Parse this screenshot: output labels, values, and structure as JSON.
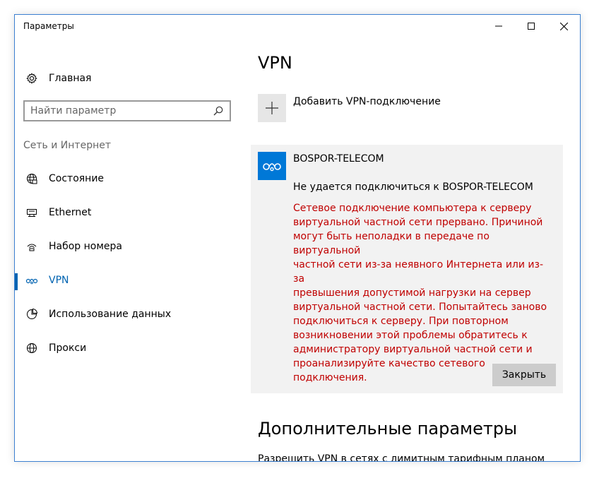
{
  "window": {
    "title": "Параметры",
    "minimize_icon": "minimize-icon",
    "maximize_icon": "maximize-icon",
    "close_icon": "close-icon"
  },
  "sidebar": {
    "home": {
      "label": "Главная",
      "icon": "gear-icon"
    },
    "search": {
      "placeholder": "Найти параметр",
      "icon": "search-icon"
    },
    "section_label": "Сеть и Интернет",
    "items": [
      {
        "label": "Состояние",
        "icon": "globe-network-icon",
        "active": false
      },
      {
        "label": "Ethernet",
        "icon": "ethernet-icon",
        "active": false
      },
      {
        "label": "Набор номера",
        "icon": "dialup-icon",
        "active": false
      },
      {
        "label": "VPN",
        "icon": "vpn-icon",
        "active": true
      },
      {
        "label": "Использование данных",
        "icon": "data-usage-icon",
        "active": false
      },
      {
        "label": "Прокси",
        "icon": "globe-icon",
        "active": false
      }
    ]
  },
  "main": {
    "title": "VPN",
    "add_vpn": {
      "label": "Добавить VPN-подключение",
      "icon": "plus-icon"
    },
    "connection": {
      "name": "BOSPOR-TELECOM",
      "icon": "vpn-icon",
      "status": "Не удается подключиться к BOSPOR-TELECOM",
      "error_lines": [
        "Сетевое подключение компьютера к серверу",
        "виртуальной частной сети прервано.  Причиной",
        "могут быть неполадки в передаче по виртуальной",
        "частной сети из-за неявного Интернета или из-за",
        "превышения допустимой нагрузки на сервер",
        "виртуальной частной сети.  Попытайтесь заново",
        "подключиться к серверу.  При повторном",
        "возникновении этой проблемы обратитесь к",
        "администратору виртуальной частной сети и",
        "проанализируйте качество сетевого подключения."
      ],
      "close_label": "Закрыть"
    },
    "advanced_title": "Дополнительные параметры",
    "metered_label": "Разрешить VPN в сетях с лимитным тарифным планом"
  },
  "colors": {
    "accent": "#0078d7",
    "accent_text": "#0063b1",
    "error": "#c00000",
    "panel": "#f2f2f2",
    "button": "#cccccc"
  }
}
